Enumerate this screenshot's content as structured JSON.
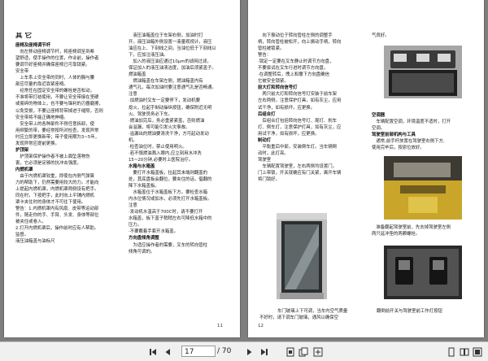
{
  "left_page": {
    "page_number": "11",
    "col1": [
      {
        "t": "其 它",
        "h": "h1"
      },
      {
        "t": "座椅及座椅调节杆",
        "h": "head"
      },
      {
        "t": "　向左移动座椅调节杆，将座椅调至到希"
      },
      {
        "t": "望舒适，使手操作的位置，作业前，操作者"
      },
      {
        "t": "要调节好座椅并确保座椅已可靠锁紧。"
      },
      {
        "t": "安全带"
      },
      {
        "t": "　上车系上安全带的同时，人体的胸与腰"
      },
      {
        "t": "部应尽量的靠近靠紧座椅。"
      },
      {
        "t": "　经常任在固定安全带的螺栓是否松动，"
      },
      {
        "t": "不准将带打结使用，不要让安全带接在坚硬"
      },
      {
        "t": "或易碎的物体上，也不要与锋利的刃器磨擦，"
      },
      {
        "t": "以免受损，不要让座椅背带掉进于缝隙，否则"
      },
      {
        "t": "安全带将不能正确地伸缩。"
      },
      {
        "t": "　安全带上的各种部件不得任意拆卸，使"
      },
      {
        "t": "用频繁的带，要经常按所对检查，发现异常"
      },
      {
        "t": "时应立即更换新带；带子使用期为3~5年，"
      },
      {
        "t": "发现异常应提前更换。"
      },
      {
        "t": "护顶架",
        "h": "head"
      },
      {
        "t": "　护顶架保护操作者不被上面坠落物伤"
      },
      {
        "t": "害，它必须是足够的抗冲击强度。"
      },
      {
        "t": "内燃机罩",
        "h": "head"
      },
      {
        "t": "　由于内燃机罩较重，即使在内侧气弹簧"
      },
      {
        "t": "力的帮助下，仍然需要用较大的力。才能向"
      },
      {
        "t": "上提起内燃机罩。内燃机罩两侧设有把手。"
      },
      {
        "t": "同在时，下按把手，此时向上平铺内燃机"
      },
      {
        "t": "罩卡夹住时的身体才不可往下使用。"
      },
      {
        "t": "警告：1.内燃机罩内有风扇、皮带等运动部"
      },
      {
        "t": "件，随走你的手、手臂、头发、身体等部位"
      },
      {
        "t": "被夹住或卷入。"
      },
      {
        "t": "2.打开内燃机罩后，操作前时应有人帮助。"
      },
      {
        "t": "监督。"
      },
      {
        "t": "液压油箱盖与油标尺"
      }
    ],
    "col2": [
      {
        "t": "　液压油箱盖位于车架右侧，加油时打"
      },
      {
        "t": "开。液压油箱外侧设置一液量观视计，液压"
      },
      {
        "t": "油应在上、下刻线之间，当油位低于下刻线以"
      },
      {
        "t": "下，应加注液压油。"
      },
      {
        "t": "　加入的液压油应通过10μm的滤网过滤，"
      },
      {
        "t": "保证加入的液压油清洁度，加油后须紧盖子。"
      },
      {
        "t": "燃油箱盖"
      },
      {
        "t": "　燃油箱盖在车架左侧，燃油箱盖内有"
      },
      {
        "t": "通气孔，每次加油时要注意通气孔是否畅通。"
      },
      {
        "t": "注意"
      },
      {
        "t": "·加燃油时叉车一定要停下，发动机要"
      },
      {
        "t": "熄火，拉起手制动操纵按钮，确保附近无明"
      },
      {
        "t": "火。驾驶员务必下车。"
      },
      {
        "t": "·燃油加完后，务必重紧紧盖，否则燃油"
      },
      {
        "t": "会溢漏，将可能引发火灾事故。"
      },
      {
        "t": "·溢漏出的燃油要清洗干净，方可起动发动"
      },
      {
        "t": "机。"
      },
      {
        "t": "·检查油位时，禁止使用明火。"
      },
      {
        "t": "·若不慎燃油溅入眼内,应立刻用水冲洗"
      },
      {
        "t": "15~20分钟,必要时上医院治疗。"
      },
      {
        "t": "水箱与水箱盖",
        "h": "head"
      },
      {
        "t": "　要打开水箱盖板，拉起其末端则翻盖的"
      },
      {
        "t": "处，其底盘板会翻位，要夹住的话，倡翻的"
      },
      {
        "t": "降下水箱盖板。"
      },
      {
        "t": "　水箱盖位于水箱盖板下方。要检查水箱"
      },
      {
        "t": "内水位情况或加水，必须先打开水箱盖板。"
      },
      {
        "t": "注意"
      },
      {
        "t": "·发动机水温高于700C时，请不要打开"
      },
      {
        "t": "水箱盖，板下盖子稍稍左右可降低水箱中的"
      },
      {
        "t": "压力。"
      },
      {
        "t": "·不要戴着手套开水箱盖。"
      },
      {
        "t": "方向盘倾角调整",
        "h": "head"
      },
      {
        "t": "　为适应操作者的需要，叉车的转向管柱"
      },
      {
        "t": "倾角可调的。"
      }
    ]
  },
  "right_page": {
    "page_number": "12",
    "col1": [
      {
        "t": "　向下振动位于转向管柱左侧的调整手"
      },
      {
        "t": "柄，转向管柱被松开，向上振动手柄，转向"
      },
      {
        "t": "管柱被锁紧。"
      },
      {
        "t": "警告："
      },
      {
        "t": "·锁定一定要在叉车静止时调节方向盘，"
      },
      {
        "t": "不要尝试在叉车行进时调节方向盘。"
      },
      {
        "t": "·在调整转后，拽上和撒下方向盘确信"
      },
      {
        "t": "它被安全锁紧。"
      },
      {
        "t": "前大灯和转向信号灯",
        "h": "head"
      },
      {
        "t": "　两只前大灯和转向信号灯安装于前车架"
      },
      {
        "t": "左右两侧，注意保护灯具，如有灰尘，应用"
      },
      {
        "t": "试干净，如有损坏，应更换。"
      },
      {
        "t": "后组合灯",
        "h": "head"
      },
      {
        "t": "　后组合灯包括转向信号灯、尾灯、刹车"
      },
      {
        "t": "灯、倒车灯，注意保护灯具，如有灰尘，应"
      },
      {
        "t": "用试干净，如有损坏，应更换。"
      },
      {
        "t": "制动灯",
        "h": "head"
      },
      {
        "t": "　平衡重后中部，安装倒车灯。当车辆倒"
      },
      {
        "t": "动时，此灯亮。"
      },
      {
        "t": "驾驶室"
      },
      {
        "t": "　车辆配置驾驶室，左右两侧均设置门，"
      },
      {
        "t": "门上带锁，开关就确应有门关紧，离开车辆"
      },
      {
        "t": "将门锁好。"
      }
    ],
    "col2_top": [
      {
        "t": "气良好。"
      }
    ],
    "col2_mid": [
      {
        "t": "空调器",
        "h": "head"
      },
      {
        "t": "　车辆配置空调，环境温度不适时，打开"
      },
      {
        "t": "空调。"
      },
      {
        "t": "驾驶室前部机构与工具",
        "h": "head"
      },
      {
        "t": "　通常,前手杆放置在驾驶室右侧下方,"
      },
      {
        "t": "使用完毕后，按原位放好。"
      }
    ],
    "col2_low": [
      {
        "t": "　准备翻起驾驶室前，先去掉驾驶室左侧"
      },
      {
        "t": "两只延冲垫的两颗螺栓。"
      }
    ],
    "caption_left": "车门玻璃上下可调，当车内空气质量",
    "caption_left2": "不好时，请下调车门玻璃，通风以确保空",
    "caption_right": "翻倒前开关与驾驶室前工作灯按钮"
  },
  "toolbar": {
    "current_page": "17",
    "total_pages": "/ 70",
    "icons": [
      "first-page-icon",
      "prev-page-icon",
      "next-page-icon",
      "last-page-icon",
      "single-page-icon",
      "two-page-icon",
      "fullscreen-icon"
    ]
  }
}
